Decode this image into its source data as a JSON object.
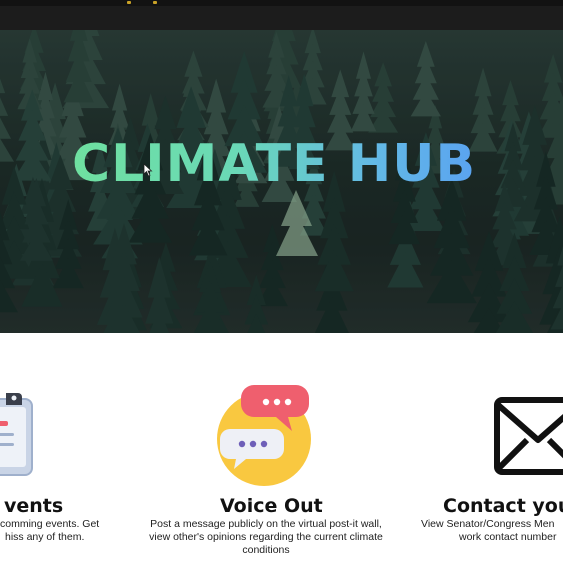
{
  "hero": {
    "title": "CLIMATE HUB"
  },
  "features": [
    {
      "title": "vents",
      "desc_line1": "comming events. Get",
      "desc_line2": "hiss any of them.",
      "icon": "clipboard-icon"
    },
    {
      "title": "Voice Out",
      "desc_line1": "Post a message publicly on the virtual post-it wall,",
      "desc_line2": "view other's opinions regarding the current climate",
      "desc_line3": "conditions",
      "icon": "chat-bubbles-icon"
    },
    {
      "title": "Contact your",
      "desc_line1": "View Senator/Congress Men",
      "desc_line2": "work contact number",
      "icon": "envelope-icon"
    }
  ],
  "colors": {
    "title_gradient_start": "#6fe0a0",
    "title_gradient_end": "#5aa3f0",
    "chat_circle": "#f9c840",
    "chat_bubble_pink": "#ef5f6e",
    "chat_dots": "#6e5fb8"
  }
}
